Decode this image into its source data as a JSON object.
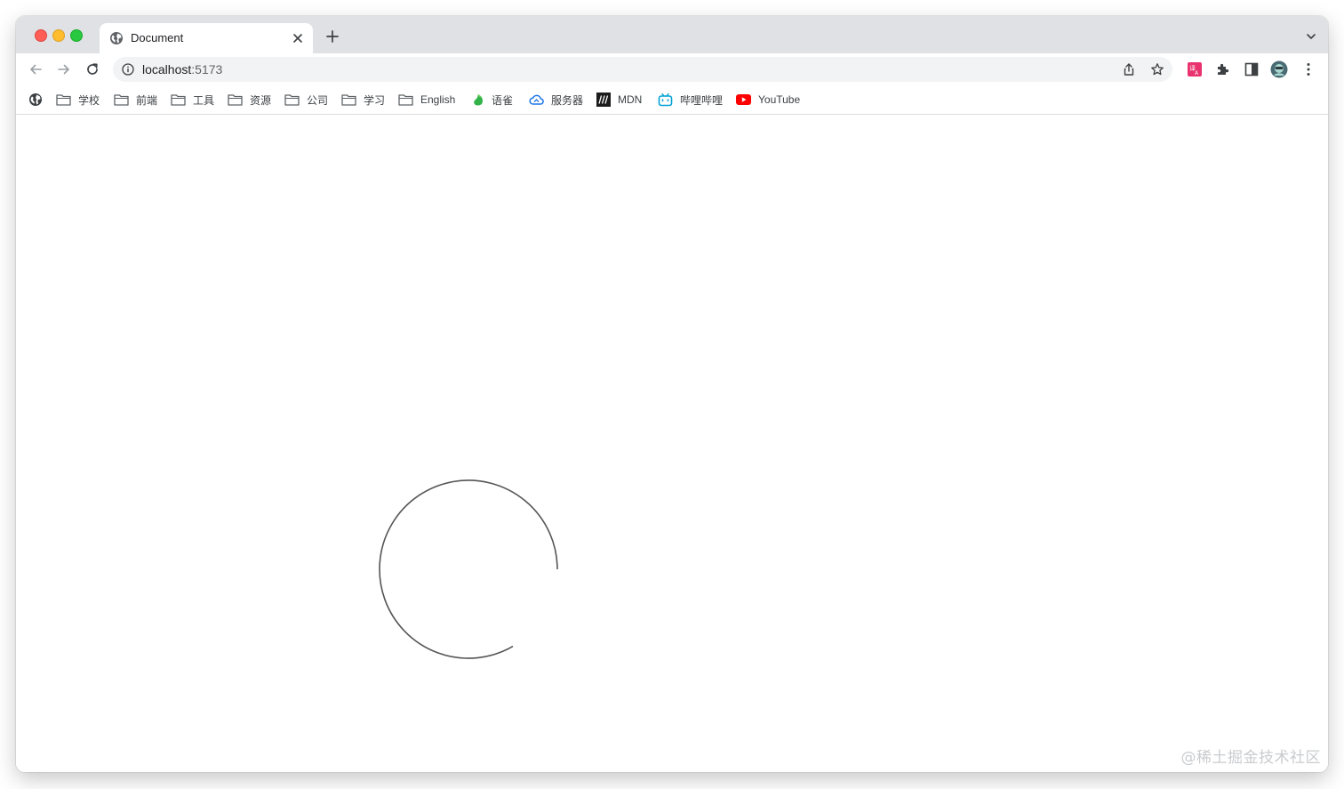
{
  "tab": {
    "title": "Document"
  },
  "address_bar": {
    "host": "localhost",
    "port": ":5173"
  },
  "bookmarks": [
    {
      "label": "学校",
      "icon": "folder-icon"
    },
    {
      "label": "前端",
      "icon": "folder-icon"
    },
    {
      "label": "工具",
      "icon": "folder-icon"
    },
    {
      "label": "资源",
      "icon": "folder-icon"
    },
    {
      "label": "公司",
      "icon": "folder-icon"
    },
    {
      "label": "学习",
      "icon": "folder-icon"
    },
    {
      "label": "English",
      "icon": "folder-icon"
    },
    {
      "label": "语雀",
      "icon": "yuque-icon"
    },
    {
      "label": "服务器",
      "icon": "cloud-icon"
    },
    {
      "label": "MDN",
      "icon": "mdn-icon"
    },
    {
      "label": "哔哩哔哩",
      "icon": "bilibili-icon"
    },
    {
      "label": "YouTube",
      "icon": "youtube-icon"
    }
  ],
  "watermark": "@稀土掘金技术社区",
  "colors": {
    "tabstrip": "#dfe1e5",
    "omnibox": "#f1f3f4",
    "spinner_stroke": "#555555"
  }
}
